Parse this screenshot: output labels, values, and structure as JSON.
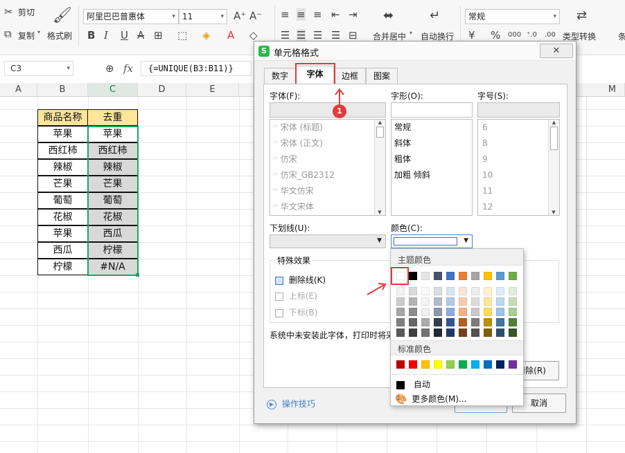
{
  "ribbon": {
    "cut": "剪切",
    "copy": "复制",
    "format_painter": "格式刷",
    "font_name": "阿里巴巴普惠体",
    "font_size": "11",
    "merge_center": "合并居中",
    "wrap": "自动换行",
    "number_format": "常规",
    "type_convert": "类型转换",
    "partial_label": "条"
  },
  "formula_bar": {
    "name_box": "C3",
    "fx": "fx",
    "formula": "{=UNIQUE(B3:B11)}"
  },
  "columns": [
    "A",
    "B",
    "C",
    "D",
    "E",
    "M"
  ],
  "table": {
    "headers": [
      "商品名称",
      "去重"
    ],
    "rows": [
      [
        "苹果",
        "苹果"
      ],
      [
        "西红柿",
        "西红柿"
      ],
      [
        "辣椒",
        "辣椒"
      ],
      [
        "芒果",
        "芒果"
      ],
      [
        "葡萄",
        "葡萄"
      ],
      [
        "花椒",
        "花椒"
      ],
      [
        "苹果",
        "西瓜"
      ],
      [
        "西瓜",
        "柠檬"
      ],
      [
        "柠檬",
        "#N/A"
      ]
    ]
  },
  "dialog": {
    "title": "单元格格式",
    "tabs": [
      "数字",
      "字体",
      "边框",
      "图案"
    ],
    "font_label": "字体(F):",
    "style_label": "字形(O):",
    "size_label": "字号(S):",
    "font_list": [
      "宋体 (标题)",
      "宋体 (正文)",
      "仿宋",
      "仿宋_GB2312",
      "华文仿宋",
      "华文宋体"
    ],
    "style_list": [
      "常规",
      "斜体",
      "粗体",
      "加粗 倾斜"
    ],
    "size_list": [
      "6",
      "8",
      "9",
      "10",
      "11",
      "12"
    ],
    "underline_label": "下划线(U):",
    "color_label": "颜色(C):",
    "effects_title": "特殊效果",
    "strikethrough": "删除线(K)",
    "superscript": "上标(E)",
    "subscript": "下标(B)",
    "note": "系统中未安装此字体，打印时将采",
    "clear_button": "清除(R)",
    "tips": "操作技巧",
    "cancel": "取消",
    "badge": "1"
  },
  "color_popup": {
    "theme_title": "主题颜色",
    "standard_title": "标准颜色",
    "auto": "自动",
    "more": "更多颜色(M)...",
    "theme_colors": [
      "#ffffff",
      "#000000",
      "#e7e6e6",
      "#44546a",
      "#4472c4",
      "#ed7d31",
      "#a5a5a5",
      "#ffc000",
      "#5b9bd5",
      "#70ad47"
    ],
    "standard_colors": [
      "#c00000",
      "#ff0000",
      "#ffc000",
      "#ffff00",
      "#92d050",
      "#00b050",
      "#00b0f0",
      "#0070c0",
      "#002060",
      "#7030a0"
    ]
  },
  "colors": {
    "accent_red": "#e23b3b",
    "header_fill": "#ffe699",
    "dedupe_fill": "#d9d9d9",
    "selection": "#21a366"
  }
}
